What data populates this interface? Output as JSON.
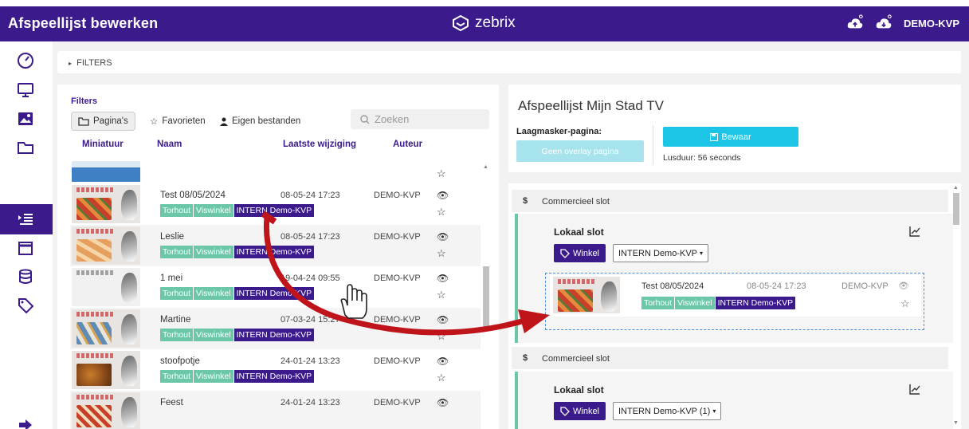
{
  "header": {
    "title": "Afspeellijst bewerken",
    "brand": "zebrix",
    "user": "DEMO-KVP"
  },
  "sidebar": {
    "icons": [
      "dashboard-icon",
      "monitor-icon",
      "image-icon",
      "folder-icon",
      "playlist-icon",
      "calendar-icon",
      "database-icon",
      "tag-icon",
      "logout-icon"
    ],
    "active": "playlist-icon"
  },
  "filters_bar": {
    "label": "FILTERS"
  },
  "left": {
    "filters_label": "Filters",
    "tabs": {
      "pages": "Pagina's",
      "favorites": "Favorieten",
      "own": "Eigen bestanden"
    },
    "search_placeholder": "Zoeken",
    "columns": {
      "thumb": "Miniatuur",
      "name": "Naam",
      "modified": "Laatste wijziging",
      "author": "Auteur"
    },
    "rows": [
      {
        "name": "Test 08/05/2024",
        "date": "08-05-24 17:23",
        "author": "DEMO-KVP",
        "tags": [
          "Torhout",
          "Viswinkel",
          "INTERN Demo-KVP"
        ]
      },
      {
        "name": "Leslie",
        "date": "08-05-24 17:23",
        "author": "DEMO-KVP",
        "tags": [
          "Torhout",
          "Viswinkel",
          "INTERN Demo-KVP"
        ]
      },
      {
        "name": "1 mei",
        "date": "19-04-24 09:55",
        "author": "DEMO-KVP",
        "tags": [
          "Torhout",
          "Viswinkel",
          "INTERN Demo-KVP"
        ]
      },
      {
        "name": "Martine",
        "date": "07-03-24 15:27",
        "author": "DEMO-KVP",
        "tags": [
          "Torhout",
          "Viswinkel",
          "INTERN Demo-KVP"
        ]
      },
      {
        "name": "stoofpotje",
        "date": "24-01-24 13:23",
        "author": "DEMO-KVP",
        "tags": [
          "Torhout",
          "Viswinkel",
          "INTERN Demo-KVP"
        ]
      },
      {
        "name": "Feest",
        "date": "24-01-24 13:23",
        "author": "DEMO-KVP",
        "tags": []
      }
    ]
  },
  "right": {
    "title": "Afspeellijst Mijn Stad TV",
    "mask_label": "Laagmasker-pagina:",
    "overlay_button": "Geen overlay pagina",
    "save_button": "Bewaar",
    "loop_duration": "Lusduur: 56 seconds",
    "slots": [
      {
        "header": "Commercieel slot",
        "title": "Lokaal slot",
        "winkel": "Winkel",
        "select": "INTERN Demo-KVP",
        "item": {
          "name": "Test 08/05/2024",
          "date": "08-05-24 17:23",
          "author": "DEMO-KVP",
          "tags": [
            "Torhout",
            "Viswinkel",
            "INTERN Demo-KVP"
          ]
        }
      },
      {
        "header": "Commercieel slot",
        "title": "Lokaal slot",
        "winkel": "Winkel",
        "select": "INTERN Demo-KVP (1)"
      }
    ]
  },
  "colors": {
    "brand": "#3b1a8c",
    "tag_green": "#6cc7a9",
    "save": "#1cc5e6",
    "arrow": "#d32f2f"
  }
}
